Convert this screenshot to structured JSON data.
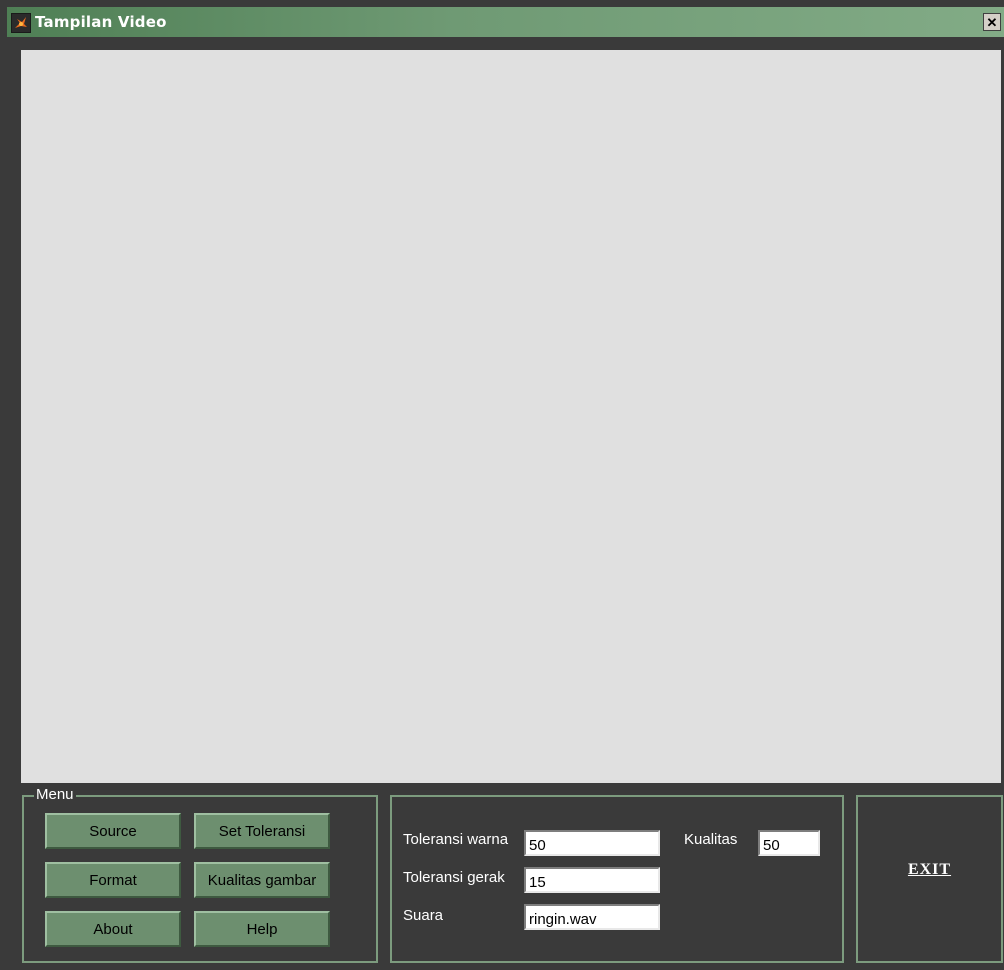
{
  "window": {
    "title": "Tampilan Video",
    "close_glyph": "✕"
  },
  "menu": {
    "legend": "Menu",
    "buttons": {
      "source": "Source",
      "set_toleransi": "Set Toleransi",
      "format": "Format",
      "kualitas_gambar": "Kualitas gambar",
      "about": "About",
      "help": "Help"
    }
  },
  "settings": {
    "toleransi_warna": {
      "label": "Toleransi warna",
      "value": "50"
    },
    "toleransi_gerak": {
      "label": "Toleransi gerak",
      "value": "15"
    },
    "suara": {
      "label": "Suara",
      "value": "ringin.wav"
    },
    "kualitas": {
      "label": "Kualitas",
      "value": "50"
    }
  },
  "exit": {
    "label": "EXIT"
  },
  "colors": {
    "title_bar": "#6f9a74",
    "button_face": "#6d8f6f",
    "group_border": "#7c9b7e",
    "background": "#3a3a3a",
    "video_area": "#e0e0e0"
  }
}
